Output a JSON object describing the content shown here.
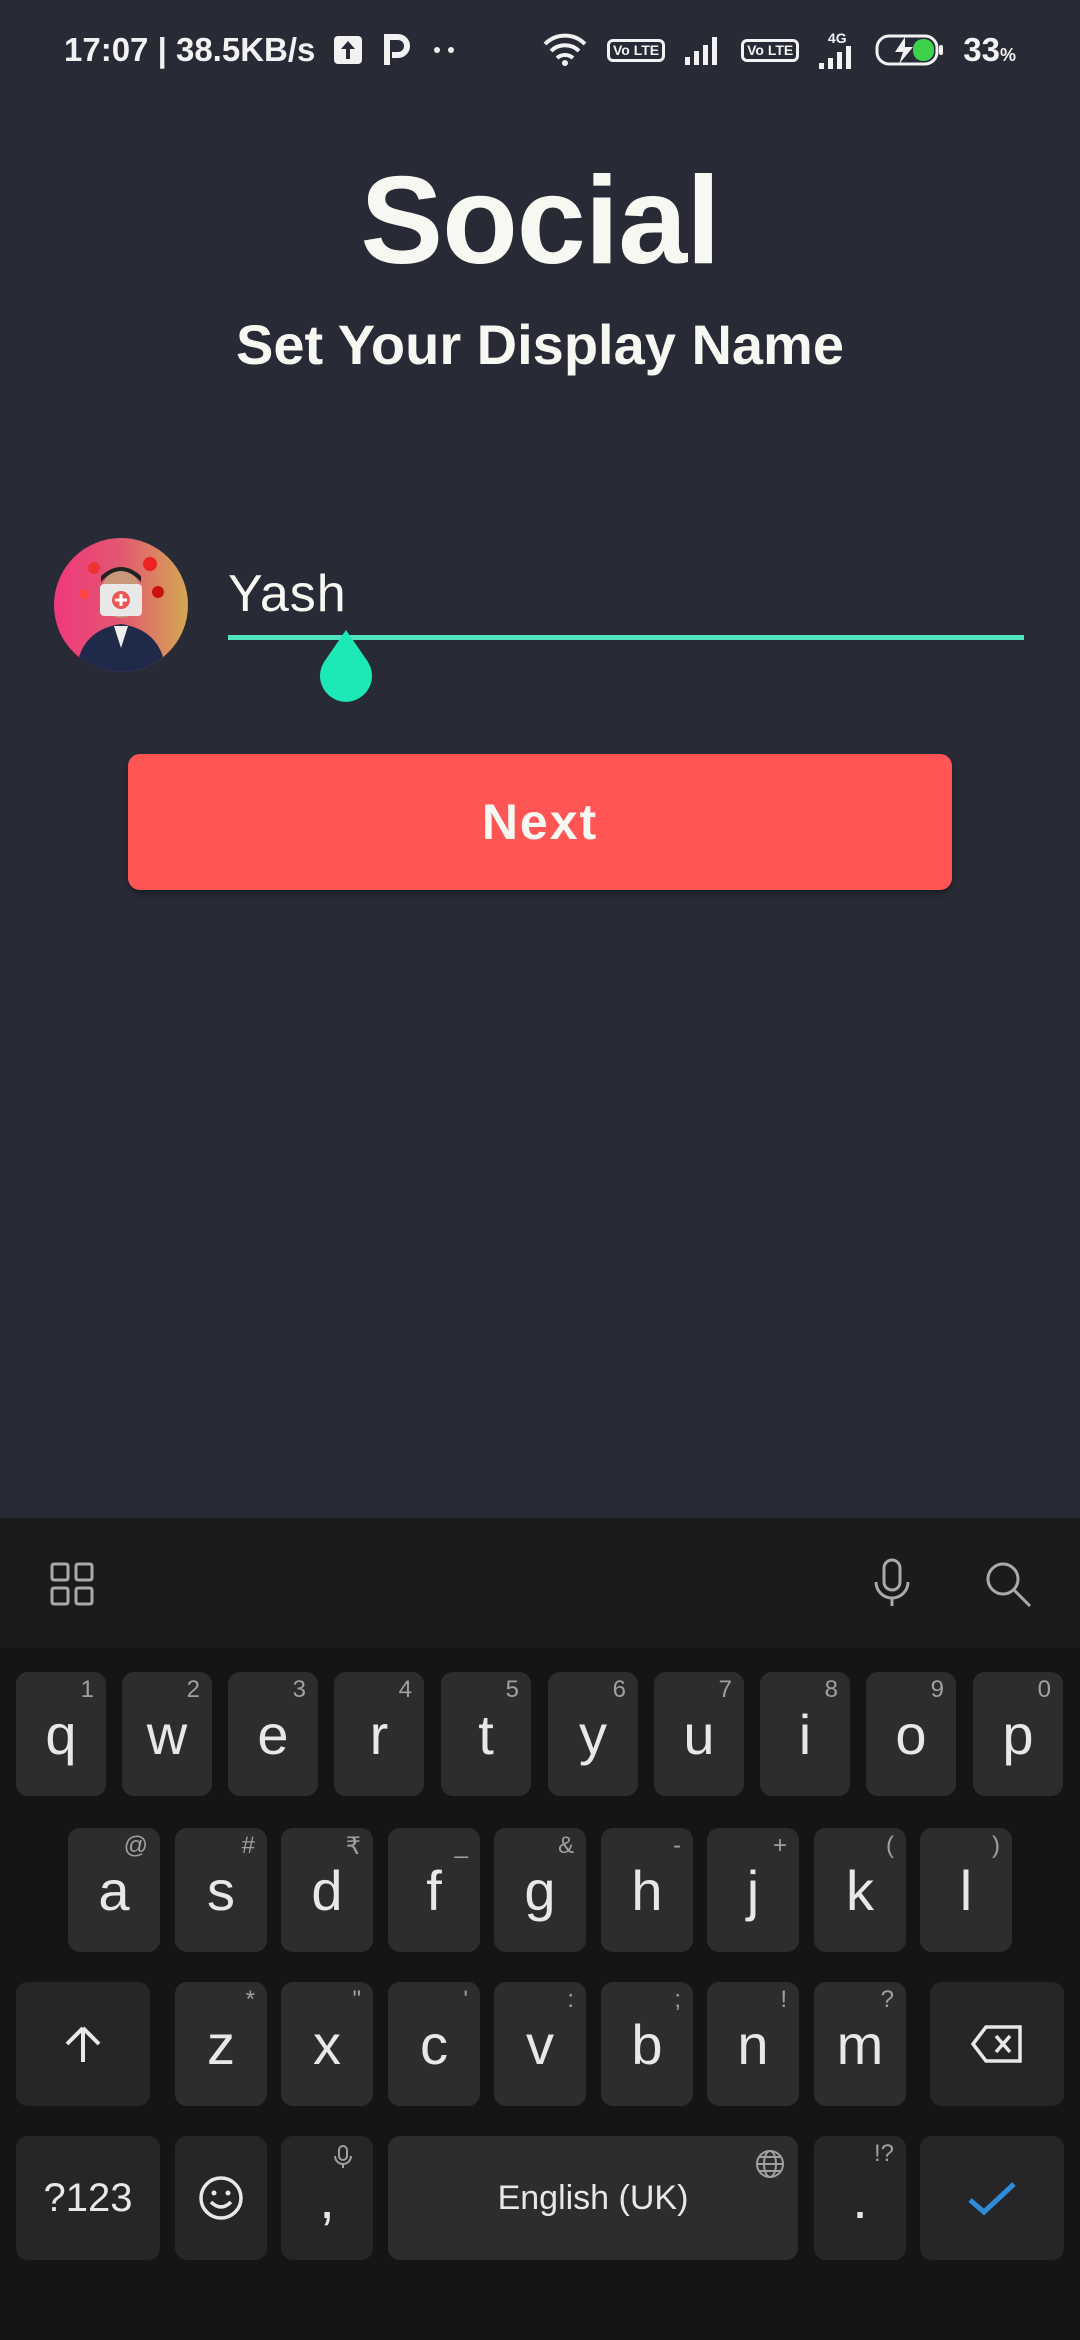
{
  "status_bar": {
    "time_speed": "17:07 | 38.5KB/s",
    "sim1_badge": "Vo LTE",
    "sim2_badge": "Vo LTE",
    "network_type": "4G",
    "battery": "33",
    "battery_unit": "%"
  },
  "header": {
    "title": "Social",
    "subtitle": "Set Your Display Name"
  },
  "form": {
    "name_value": "Yash",
    "next_label": "Next"
  },
  "colors": {
    "background": "#282a36",
    "accent": "#50e3c2",
    "button": "#ff5555"
  },
  "keyboard": {
    "row1": [
      {
        "key": "q",
        "hint": "1"
      },
      {
        "key": "w",
        "hint": "2"
      },
      {
        "key": "e",
        "hint": "3"
      },
      {
        "key": "r",
        "hint": "4"
      },
      {
        "key": "t",
        "hint": "5"
      },
      {
        "key": "y",
        "hint": "6"
      },
      {
        "key": "u",
        "hint": "7"
      },
      {
        "key": "i",
        "hint": "8"
      },
      {
        "key": "o",
        "hint": "9"
      },
      {
        "key": "p",
        "hint": "0"
      }
    ],
    "row2": [
      {
        "key": "a",
        "hint": "@"
      },
      {
        "key": "s",
        "hint": "#"
      },
      {
        "key": "d",
        "hint": "₹"
      },
      {
        "key": "f",
        "hint": "_"
      },
      {
        "key": "g",
        "hint": "&"
      },
      {
        "key": "h",
        "hint": "-"
      },
      {
        "key": "j",
        "hint": "+"
      },
      {
        "key": "k",
        "hint": "("
      },
      {
        "key": "l",
        "hint": ")"
      }
    ],
    "row3": [
      {
        "key": "z",
        "hint": "*"
      },
      {
        "key": "x",
        "hint": "\""
      },
      {
        "key": "c",
        "hint": "'"
      },
      {
        "key": "v",
        "hint": ":"
      },
      {
        "key": "b",
        "hint": ";"
      },
      {
        "key": "n",
        "hint": "!"
      },
      {
        "key": "m",
        "hint": "?"
      }
    ],
    "symbols_label": "?123",
    "comma_label": ",",
    "space_label": "English (UK)",
    "period_label": ".",
    "period_hint": "!?"
  }
}
